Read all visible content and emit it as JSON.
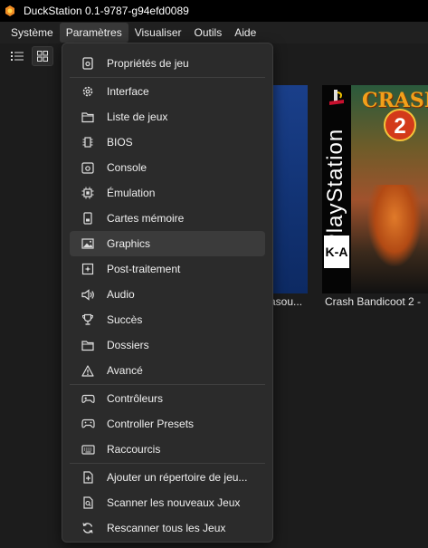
{
  "window": {
    "title": "DuckStation 0.1-9787-g94efd0089"
  },
  "menubar": {
    "items": [
      "Système",
      "Paramètres",
      "Visualiser",
      "Outils",
      "Aide"
    ]
  },
  "games": [
    {
      "title": "asou..."
    },
    {
      "title": "Crash Bandicoot 2 -"
    }
  ],
  "cover": {
    "platform_text": "PlayStation",
    "rating": "K-A",
    "logo": "CRASH",
    "number": "2"
  },
  "menu": {
    "groups": [
      [
        {
          "label": "Propriétés de jeu",
          "icon": "properties-icon"
        }
      ],
      [
        {
          "label": "Interface",
          "icon": "gear-icon"
        },
        {
          "label": "Liste de jeux",
          "icon": "folder-icon"
        },
        {
          "label": "BIOS",
          "icon": "chip-icon"
        },
        {
          "label": "Console",
          "icon": "console-icon"
        },
        {
          "label": "Émulation",
          "icon": "cpu-icon"
        },
        {
          "label": "Cartes mémoire",
          "icon": "memory-card-icon"
        },
        {
          "label": "Graphics",
          "icon": "image-icon",
          "highlighted": true
        },
        {
          "label": "Post-traitement",
          "icon": "sparkle-icon"
        },
        {
          "label": "Audio",
          "icon": "speaker-icon"
        },
        {
          "label": "Succès",
          "icon": "trophy-icon"
        },
        {
          "label": "Dossiers",
          "icon": "folder-icon"
        },
        {
          "label": "Avancé",
          "icon": "warning-icon"
        }
      ],
      [
        {
          "label": "Contrôleurs",
          "icon": "gamepad-icon"
        },
        {
          "label": "Controller Presets",
          "icon": "gamepad-preset-icon"
        },
        {
          "label": "Raccourcis",
          "icon": "keyboard-icon"
        }
      ],
      [
        {
          "label": "Ajouter un répertoire de jeu...",
          "icon": "add-folder-icon"
        },
        {
          "label": "Scanner les nouveaux Jeux",
          "icon": "scan-icon"
        },
        {
          "label": "Rescanner tous les Jeux",
          "icon": "refresh-icon"
        }
      ]
    ]
  }
}
